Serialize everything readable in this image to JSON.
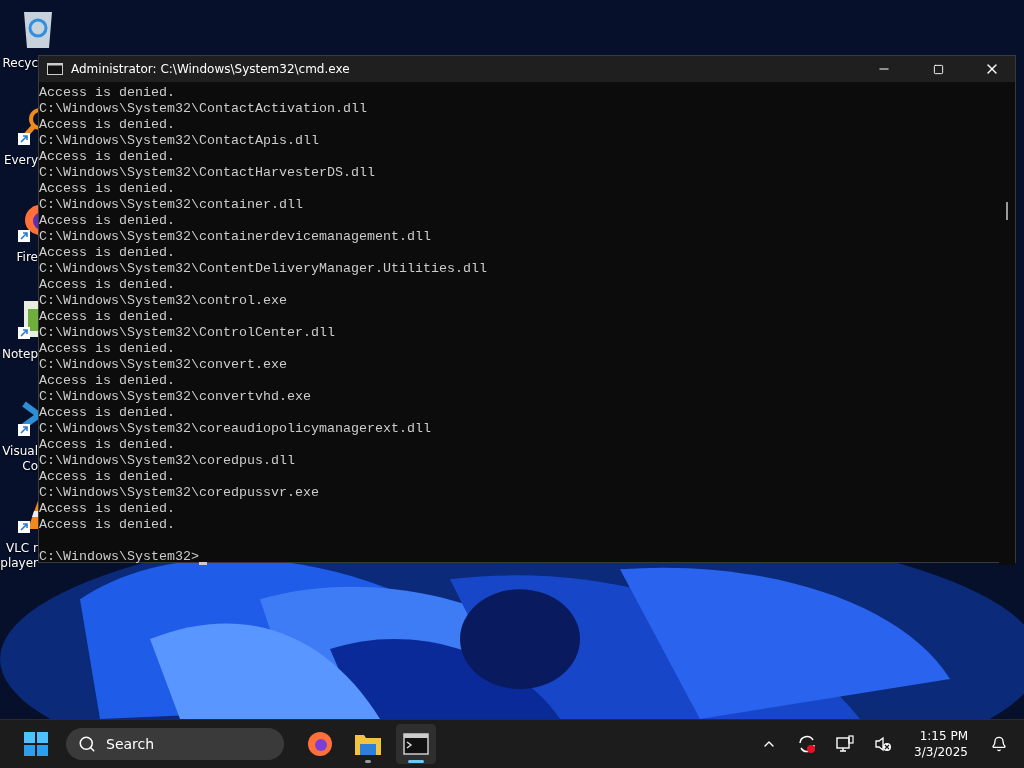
{
  "desktop_icons": [
    {
      "kind": "recycle-bin",
      "label": [
        "Recyc"
      ]
    },
    {
      "kind": "search-app",
      "label": [
        "Every"
      ]
    },
    {
      "kind": "browser",
      "label": [
        "Fire"
      ]
    },
    {
      "kind": "notepad",
      "label": [
        "Notep"
      ]
    },
    {
      "kind": "code-editor",
      "label": [
        "Visual",
        "Co"
      ]
    },
    {
      "kind": "media-player",
      "label": [
        "VLC r",
        "player"
      ]
    }
  ],
  "window": {
    "title": "Administrator: C:\\Windows\\System32\\cmd.exe",
    "lines": [
      "Access is denied.",
      "C:\\Windows\\System32\\ContactActivation.dll",
      "Access is denied.",
      "C:\\Windows\\System32\\ContactApis.dll",
      "Access is denied.",
      "C:\\Windows\\System32\\ContactHarvesterDS.dll",
      "Access is denied.",
      "C:\\Windows\\System32\\container.dll",
      "Access is denied.",
      "C:\\Windows\\System32\\containerdevicemanagement.dll",
      "Access is denied.",
      "C:\\Windows\\System32\\ContentDeliveryManager.Utilities.dll",
      "Access is denied.",
      "C:\\Windows\\System32\\control.exe",
      "Access is denied.",
      "C:\\Windows\\System32\\ControlCenter.dll",
      "Access is denied.",
      "C:\\Windows\\System32\\convert.exe",
      "Access is denied.",
      "C:\\Windows\\System32\\convertvhd.exe",
      "Access is denied.",
      "C:\\Windows\\System32\\coreaudiopolicymanagerext.dll",
      "Access is denied.",
      "C:\\Windows\\System32\\coredpus.dll",
      "Access is denied.",
      "C:\\Windows\\System32\\coredpussvr.exe",
      "Access is denied.",
      "Access is denied."
    ],
    "prompt": "C:\\Windows\\System32>"
  },
  "taskbar": {
    "search": "Search",
    "apps": [
      {
        "kind": "browser",
        "running": false,
        "active": false
      },
      {
        "kind": "folder",
        "running": true,
        "active": false
      },
      {
        "kind": "terminal",
        "running": true,
        "active": true
      }
    ],
    "tray": [
      {
        "kind": "chevron"
      },
      {
        "kind": "sync"
      },
      {
        "kind": "network"
      },
      {
        "kind": "volume-muted"
      }
    ],
    "time": "1:15 PM",
    "date": "3/3/2025"
  }
}
